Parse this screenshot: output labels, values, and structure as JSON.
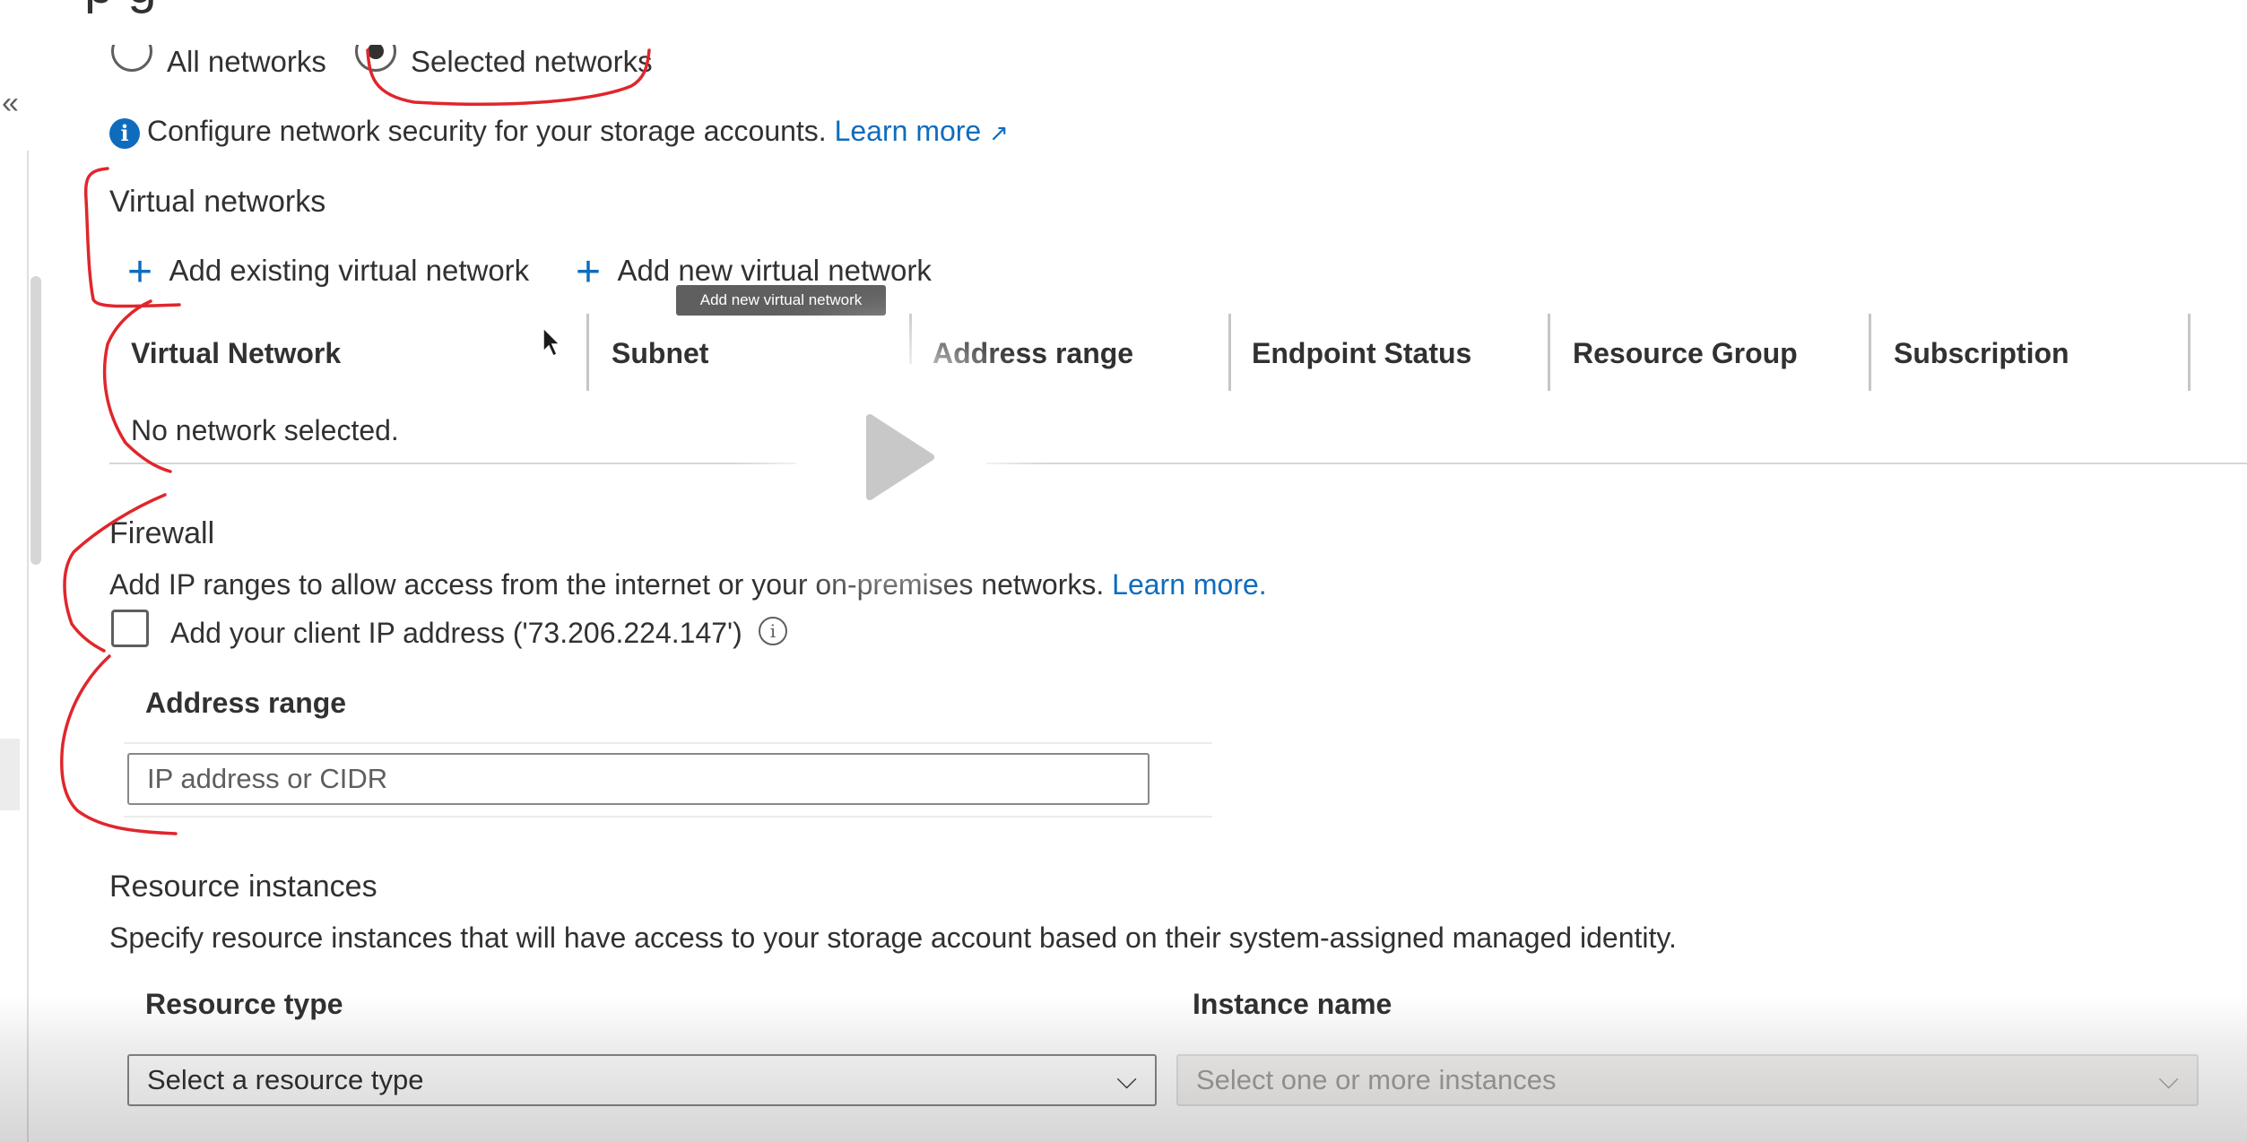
{
  "page": {
    "title_partial": "p      g"
  },
  "network_access": {
    "option_all": "All networks",
    "option_selected": "Selected networks"
  },
  "info": {
    "text": "Configure network security for your storage accounts.",
    "link": "Learn more"
  },
  "virtual_networks": {
    "title": "Virtual networks",
    "add_existing": "Add existing virtual network",
    "add_new": "Add new virtual network",
    "tooltip": "Add new virtual network",
    "columns": [
      "Virtual Network",
      "Subnet",
      "Address range",
      "Endpoint Status",
      "Resource Group",
      "Subscription"
    ],
    "empty_text": "No network selected."
  },
  "firewall": {
    "title": "Firewall",
    "description": "Add IP ranges to allow access from the internet or your on-premises networks.",
    "link": "Learn more.",
    "client_ip_label": "Add your client IP address ('73.206.224.147')",
    "client_ip_checked": false,
    "address_range_header": "Address range",
    "address_placeholder": "IP address or CIDR"
  },
  "resource_instances": {
    "title": "Resource instances",
    "description": "Specify resource instances that will have access to your storage account based on their system-assigned managed identity.",
    "resource_type_header": "Resource type",
    "instance_name_header": "Instance name",
    "resource_type_placeholder": "Select a resource type",
    "instance_placeholder": "Select one or more instances"
  },
  "icons": {
    "collapse": "double-chevron-left-icon",
    "info": "info-icon",
    "external": "external-link-icon",
    "add": "plus-icon",
    "cursor": "mouse-pointer-icon",
    "play": "play-icon",
    "chevron": "chevron-down-icon"
  },
  "colors": {
    "accent": "#0f6cbd",
    "annotation": "#e0262c",
    "text": "#323130"
  }
}
